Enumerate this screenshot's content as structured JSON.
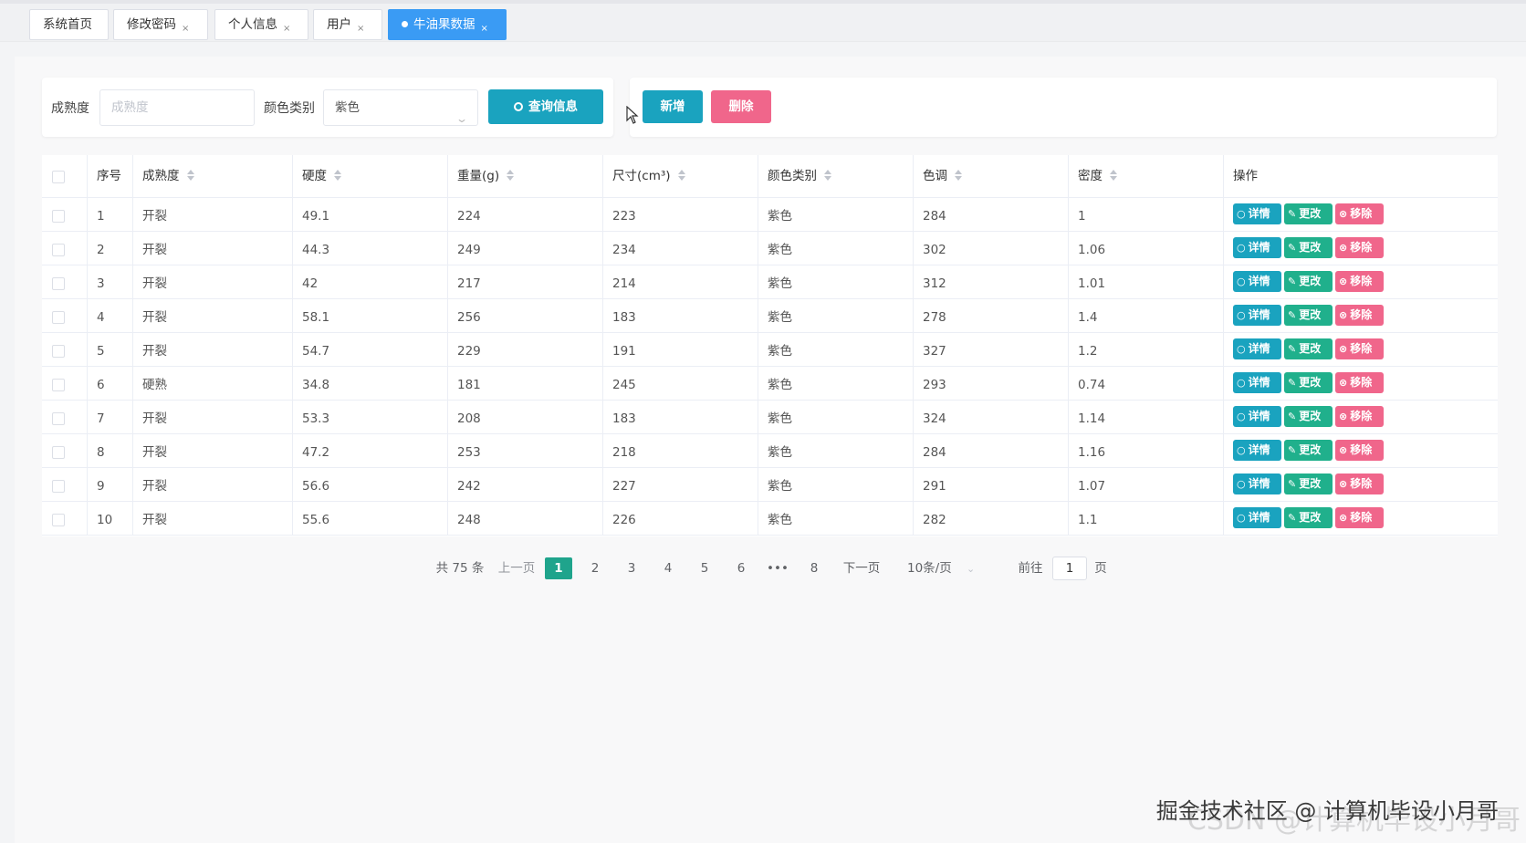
{
  "tabs": [
    {
      "label": "系统首页",
      "closable": false,
      "active": false
    },
    {
      "label": "修改密码",
      "closable": true,
      "active": false
    },
    {
      "label": "个人信息",
      "closable": true,
      "active": false
    },
    {
      "label": "用户",
      "closable": true,
      "active": false
    },
    {
      "label": "牛油果数据",
      "closable": true,
      "active": true
    }
  ],
  "filter": {
    "ripeness_label": "成熟度",
    "ripeness_placeholder": "成熟度",
    "color_label": "颜色类别",
    "color_value": "紫色",
    "query_button": "查询信息"
  },
  "actions": {
    "add_button": "新增",
    "delete_button": "删除"
  },
  "table": {
    "columns": [
      "序号",
      "成熟度",
      "硬度",
      "重量(g)",
      "尺寸(cm³)",
      "颜色类别",
      "色调",
      "密度",
      "操作"
    ],
    "rows": [
      [
        "1",
        "开裂",
        "49.1",
        "224",
        "223",
        "紫色",
        "284",
        "1"
      ],
      [
        "2",
        "开裂",
        "44.3",
        "249",
        "234",
        "紫色",
        "302",
        "1.06"
      ],
      [
        "3",
        "开裂",
        "42",
        "217",
        "214",
        "紫色",
        "312",
        "1.01"
      ],
      [
        "4",
        "开裂",
        "58.1",
        "256",
        "183",
        "紫色",
        "278",
        "1.4"
      ],
      [
        "5",
        "开裂",
        "54.7",
        "229",
        "191",
        "紫色",
        "327",
        "1.2"
      ],
      [
        "6",
        "硬熟",
        "34.8",
        "181",
        "245",
        "紫色",
        "293",
        "0.74"
      ],
      [
        "7",
        "开裂",
        "53.3",
        "208",
        "183",
        "紫色",
        "324",
        "1.14"
      ],
      [
        "8",
        "开裂",
        "47.2",
        "253",
        "218",
        "紫色",
        "284",
        "1.16"
      ],
      [
        "9",
        "开裂",
        "56.6",
        "242",
        "227",
        "紫色",
        "291",
        "1.07"
      ],
      [
        "10",
        "开裂",
        "55.6",
        "248",
        "226",
        "紫色",
        "282",
        "1.1"
      ]
    ],
    "row_actions": {
      "detail": "详情",
      "edit": "更改",
      "remove": "移除"
    }
  },
  "pagination": {
    "total": "共 75 条",
    "prev": "上一页",
    "pages": [
      "1",
      "2",
      "3",
      "4",
      "5",
      "6",
      "•••",
      "8"
    ],
    "current": "1",
    "next": "下一页",
    "page_size": "10条/页",
    "goto_label": "前往",
    "goto_value": "1",
    "goto_suffix": "页"
  },
  "watermark": "掘金技术社区 @ 计算机毕设小月哥",
  "watermark_ghost": "CSDN @计算机毕设小月哥",
  "colors": {
    "primary": "#3a9bf4",
    "teal": "#1aa3bf",
    "green": "#20b08c",
    "pink": "#f0668b",
    "page_active": "#1fa48c"
  }
}
